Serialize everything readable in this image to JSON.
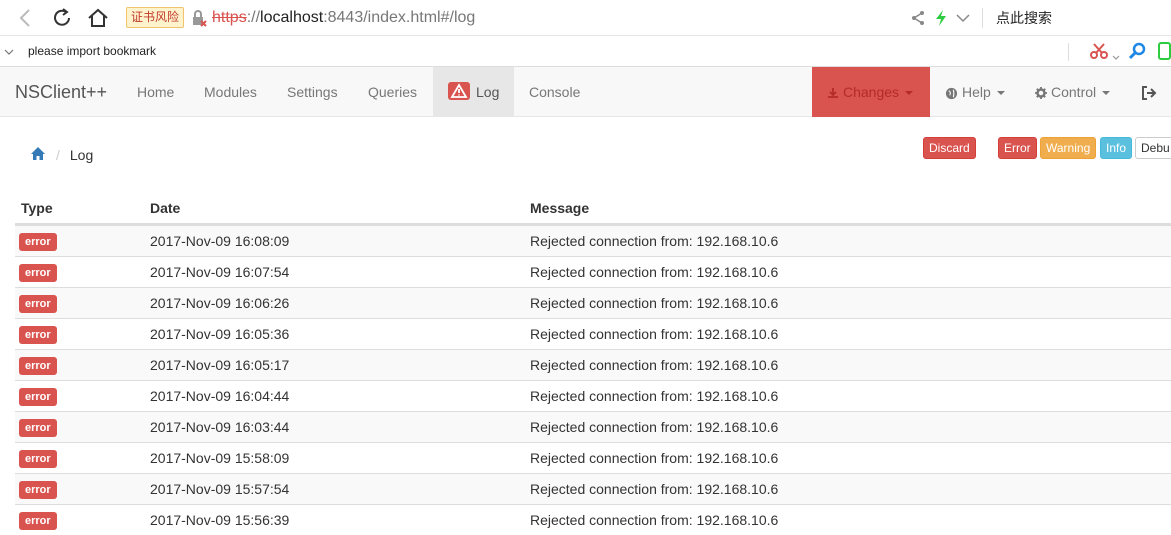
{
  "browser": {
    "cert_warning": "证书风险",
    "url_protocol": "https",
    "url_sep": "://",
    "url_host": "localhost",
    "url_rest": ":8443/index.html#/log",
    "search_placeholder": "点此搜索",
    "bookmark_text": "please import bookmark"
  },
  "navbar": {
    "brand": "NSClient++",
    "items": [
      {
        "label": "Home"
      },
      {
        "label": "Modules"
      },
      {
        "label": "Settings"
      },
      {
        "label": "Queries"
      },
      {
        "label": "Log"
      },
      {
        "label": "Console"
      }
    ],
    "changes": "Changes",
    "help": "Help",
    "control": "Control"
  },
  "breadcrumb": {
    "current": "Log"
  },
  "buttons": {
    "discard": "Discard",
    "error": "Error",
    "warning": "Warning",
    "info": "Info",
    "debug": "Debu"
  },
  "table": {
    "headers": {
      "type": "Type",
      "date": "Date",
      "message": "Message"
    },
    "rows": [
      {
        "type": "error",
        "date": "2017-Nov-09 16:08:09",
        "message": "Rejected connection from: 192.168.10.6"
      },
      {
        "type": "error",
        "date": "2017-Nov-09 16:07:54",
        "message": "Rejected connection from: 192.168.10.6"
      },
      {
        "type": "error",
        "date": "2017-Nov-09 16:06:26",
        "message": "Rejected connection from: 192.168.10.6"
      },
      {
        "type": "error",
        "date": "2017-Nov-09 16:05:36",
        "message": "Rejected connection from: 192.168.10.6"
      },
      {
        "type": "error",
        "date": "2017-Nov-09 16:05:17",
        "message": "Rejected connection from: 192.168.10.6"
      },
      {
        "type": "error",
        "date": "2017-Nov-09 16:04:44",
        "message": "Rejected connection from: 192.168.10.6"
      },
      {
        "type": "error",
        "date": "2017-Nov-09 16:03:44",
        "message": "Rejected connection from: 192.168.10.6"
      },
      {
        "type": "error",
        "date": "2017-Nov-09 15:58:09",
        "message": "Rejected connection from: 192.168.10.6"
      },
      {
        "type": "error",
        "date": "2017-Nov-09 15:57:54",
        "message": "Rejected connection from: 192.168.10.6"
      },
      {
        "type": "error",
        "date": "2017-Nov-09 15:56:39",
        "message": "Rejected connection from: 192.168.10.6"
      }
    ]
  },
  "colors": {
    "danger": "#d9534f",
    "warning": "#f0ad4e",
    "info": "#5bc0de",
    "navbar_bg": "#f8f8f8"
  },
  "icons": {
    "back": "chevron-left-icon",
    "reload": "reload-icon",
    "home": "home-icon",
    "insecure_lock": "insecure-lock-icon",
    "share": "share-icon",
    "lightning": "lightning-icon",
    "dropdown": "chevron-down-icon",
    "scissors": "scissors-icon",
    "search": "search-icon",
    "warning": "warning-icon",
    "download": "download-icon",
    "globe": "globe-icon",
    "gear": "gear-icon",
    "logout": "logout-icon"
  }
}
